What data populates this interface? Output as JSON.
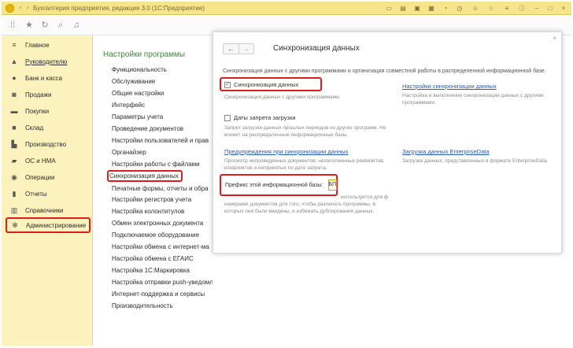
{
  "app": {
    "title": "Бухгалтерия предприятия, редакция 3.0  (1С:Предприятие)",
    "logo_text": "1С"
  },
  "colors": {
    "sidebar_bg": "#fbf2bd",
    "titlebar_bg": "#f6e58a",
    "accent_green": "#3a8a3a",
    "highlight_red": "#e01c1c",
    "link_blue": "#2a5bb8"
  },
  "sidebar": {
    "items": [
      {
        "label": "Главное",
        "icon": "menu-lines-icon"
      },
      {
        "label": "Руководителю",
        "icon": "chart-icon"
      },
      {
        "label": "Банк и касса",
        "icon": "coin-icon"
      },
      {
        "label": "Продажи",
        "icon": "bag-icon"
      },
      {
        "label": "Покупки",
        "icon": "cart-icon"
      },
      {
        "label": "Склад",
        "icon": "warehouse-icon"
      },
      {
        "label": "Производство",
        "icon": "factory-icon"
      },
      {
        "label": "ОС и НМА",
        "icon": "truck-icon"
      },
      {
        "label": "Операции",
        "icon": "operations-icon"
      },
      {
        "label": "Отчеты",
        "icon": "report-icon"
      },
      {
        "label": "Справочники",
        "icon": "book-icon"
      },
      {
        "label": "Администрирование",
        "icon": "gear-icon"
      }
    ]
  },
  "settings": {
    "title": "Настройки программы",
    "items": [
      "Функциональность",
      "Обслуживание",
      "Общие настройки",
      "Интерфейс",
      "Параметры учета",
      "Проведение документов",
      "Настройки пользователей и прав",
      "Органайзер",
      "Настройки работы с файлами",
      "Синхронизация данных",
      "Печатные формы, отчеты и обра",
      "Настройки регистров учета",
      "Настройка колонтитулов",
      "Обмен электронных документа",
      "Подключаемое оборудование",
      "Настройки обмена с интернет-ма",
      "Настройка обмена с ЕГАИС",
      "Настройка 1С:Маркировка",
      "Настройка отправки push-уведомлений",
      "Интернет-поддержка и сервисы",
      "Производительность"
    ]
  },
  "dialog": {
    "title": "Синхронизация данных",
    "close": "×",
    "description": "Синхронизация данных с другими программами и организация совместной работы в распределенной информационной базе.",
    "sync_checkbox": {
      "label": "Синхронизация данных",
      "checked": true
    },
    "sync_hint": "Синхронизация данных с другими программами.",
    "sync_settings_link": "Настройки синхронизации данных",
    "sync_settings_hint": "Настройка и выполнение синхронизации данных с другими программами.",
    "ban_checkbox": {
      "label": "Даты запрета загрузки",
      "checked": false
    },
    "ban_hint": "Запрет загрузки данных прошлых периодов из других программ. Не влияет на распределенные информационные базы.",
    "warnings_link": "Предупреждения при синхронизации данных",
    "warnings_hint": "Просмотр непроведенных документов, незаполненных реквизитов, конфликтов и непринятых по дате запрета.",
    "enterprise_link": "Загрузка данных EnterpriseData",
    "enterprise_hint": "Загрузка данных, представленных в формате EnterpriseData.",
    "prefix_label": "Префикс этой информационной базы:",
    "prefix_value": "БП",
    "prefix_hint_top": "используется для формирования справочников и",
    "prefix_hint": "номерами документов для того, чтобы различать программы, в которых они были введены, и избежать дублирования данных."
  }
}
